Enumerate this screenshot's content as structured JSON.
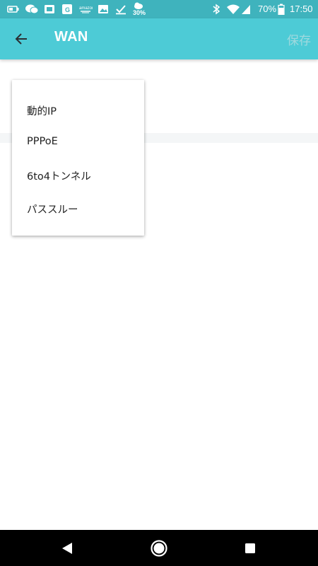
{
  "status_bar": {
    "weather_percent": "30%",
    "battery_percent": "70%",
    "time": "17:50",
    "icons": [
      "battery-saver-icon",
      "chat-bubbles-icon",
      "wallet-icon",
      "maps-icon",
      "amazon-icon",
      "image-icon",
      "task-check-icon",
      "weather-icon",
      "bluetooth-icon",
      "wifi-icon",
      "signal-icon",
      "battery-icon"
    ]
  },
  "app_bar": {
    "title": "WAN",
    "save_label": "保存",
    "back_icon": "arrow-left-icon"
  },
  "menu": {
    "items": [
      {
        "label": "動的IP"
      },
      {
        "label": "PPPoE"
      },
      {
        "label": "6to4トンネル"
      },
      {
        "label": "パススルー"
      }
    ]
  },
  "nav_bar": {
    "icons": [
      "back-triangle-icon",
      "home-circle-icon",
      "recents-square-icon"
    ]
  },
  "colors": {
    "status_bar": "#3fb3bd",
    "app_bar": "#4dcbd6",
    "save_disabled": "#9fd9de",
    "menu_text": "#212121",
    "nav_bar": "#000000"
  }
}
